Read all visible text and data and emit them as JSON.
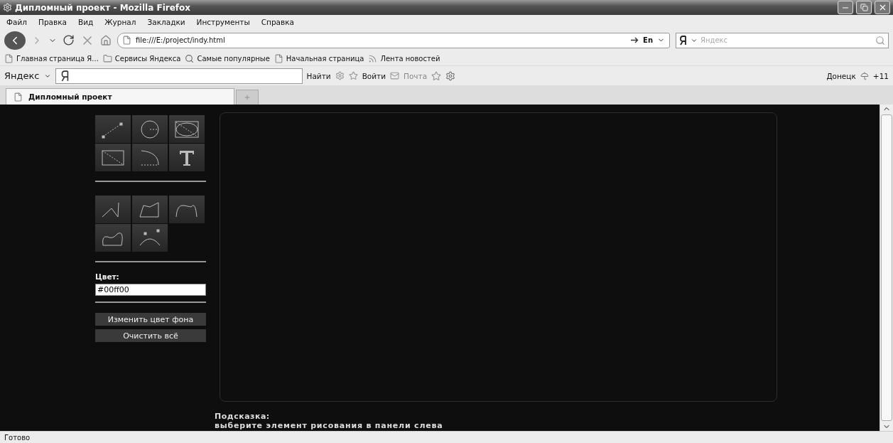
{
  "window": {
    "title": "Дипломный проект - Mozilla Firefox"
  },
  "menu": [
    "Файл",
    "Правка",
    "Вид",
    "Журнал",
    "Закладки",
    "Инструменты",
    "Справка"
  ],
  "navigation": {
    "url": "file:///E:/project/indy.html",
    "language": "En",
    "search_placeholder": "Яндекс"
  },
  "bookmarks": [
    {
      "label": "Главная страница Я...",
      "kind": "page"
    },
    {
      "label": "Сервисы Яндекса",
      "kind": "folder"
    },
    {
      "label": "Самые популярные",
      "kind": "smart"
    },
    {
      "label": "Начальная страница",
      "kind": "page"
    },
    {
      "label": "Лента новостей",
      "kind": "feed"
    }
  ],
  "yandex_bar": {
    "brand": "Яндекс",
    "find": "Найти",
    "login": "Войти",
    "mail": "Почта",
    "city": "Донецк",
    "temperature": "+11"
  },
  "tabs": [
    {
      "label": "Дипломный проект",
      "selected": true
    }
  ],
  "page": {
    "color_label": "Цвет:",
    "color_value": "#00ff00",
    "buttons": [
      "Изменить цвет фона",
      "Очистить всё"
    ],
    "hint_title": "Подсказка:",
    "hint_text": "выберите элемент рисования в панели слева"
  },
  "status_bar": {
    "text": "Готово"
  }
}
